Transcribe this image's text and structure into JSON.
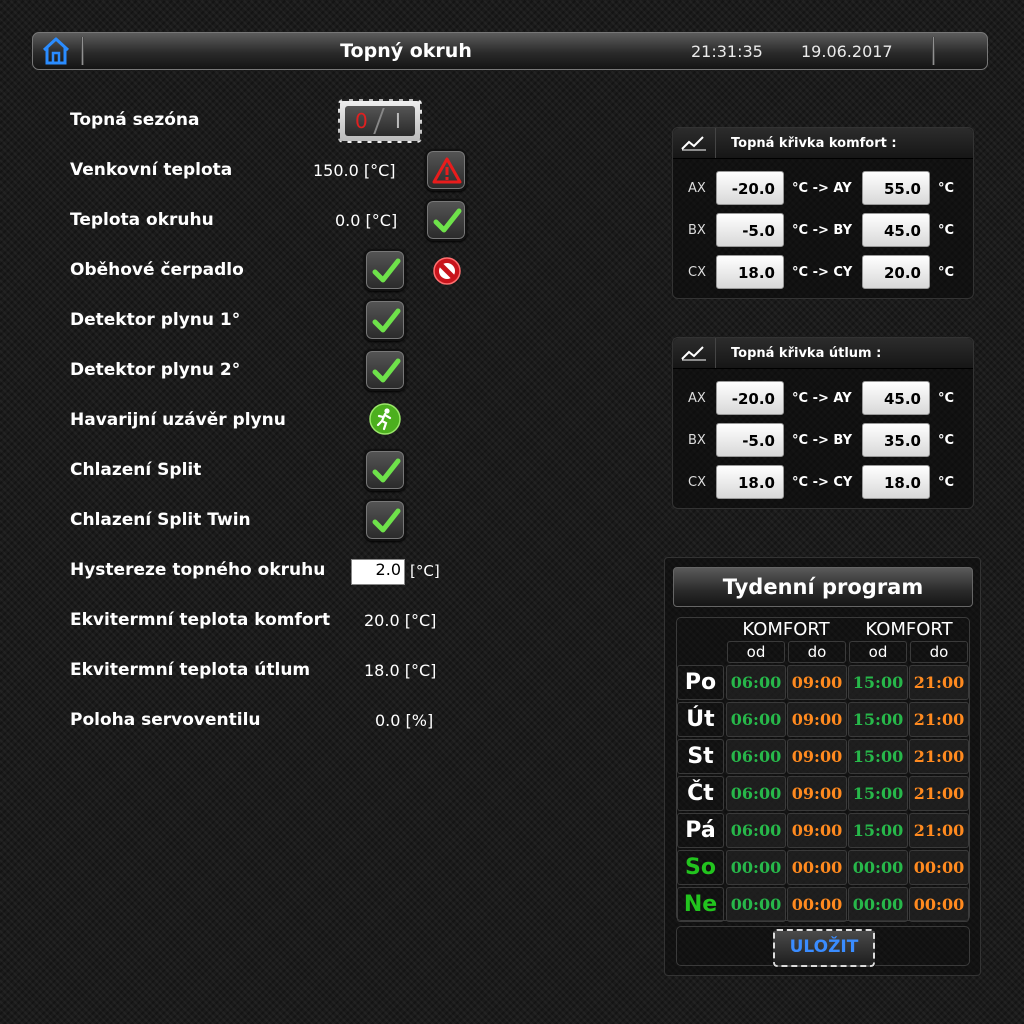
{
  "header": {
    "title": "Topný okruh",
    "time": "21:31:35",
    "date": "19.06.2017",
    "home_icon": "home-icon"
  },
  "rows": [
    {
      "label": "Topná sezóna",
      "control": "toggle",
      "toggle_off": "0",
      "toggle_on": "I",
      "state": "off"
    },
    {
      "label": "Venkovní teplota",
      "value": "150.0 [°C]",
      "status_icon": "warning-icon"
    },
    {
      "label": "Teplota okruhu",
      "value": "0.0 [°C]",
      "status_icon": "check-icon"
    },
    {
      "label": "Oběhové čerpadlo",
      "status_icon": "check-icon",
      "extra_icon": "forbidden-icon"
    },
    {
      "label": "Detektor plynu 1°",
      "status_icon": "check-icon"
    },
    {
      "label": "Detektor plynu 2°",
      "status_icon": "check-icon"
    },
    {
      "label": "Havarijní uzávěr plynu",
      "status_icon": "running-man-icon"
    },
    {
      "label": "Chlazení Split",
      "status_icon": "check-icon"
    },
    {
      "label": "Chlazení Split Twin",
      "status_icon": "check-icon"
    },
    {
      "label": "Hystereze topného okruhu",
      "input_value": "2.0",
      "unit": "[°C]"
    },
    {
      "label": "Ekvitermní teplota komfort",
      "value": "20.0 [°C]"
    },
    {
      "label": "Ekvitermní teplota útlum",
      "value": "18.0 [°C]"
    },
    {
      "label": "Poloha servoventilu",
      "value": "0.0 [%]"
    }
  ],
  "curve_comfort": {
    "title": "Topná křivka komfort :",
    "icon": "chart-line-icon",
    "rows": [
      {
        "in_label": "AX",
        "in_value": "-20.0",
        "arrow": "°C -> AY",
        "out_value": "55.0",
        "unit": "°C"
      },
      {
        "in_label": "BX",
        "in_value": "-5.0",
        "arrow": "°C -> BY",
        "out_value": "45.0",
        "unit": "°C"
      },
      {
        "in_label": "CX",
        "in_value": "18.0",
        "arrow": "°C -> CY",
        "out_value": "20.0",
        "unit": "°C"
      }
    ]
  },
  "curve_setback": {
    "title": "Topná křivka útlum :",
    "icon": "chart-line-icon",
    "rows": [
      {
        "in_label": "AX",
        "in_value": "-20.0",
        "arrow": "°C -> AY",
        "out_value": "45.0",
        "unit": "°C"
      },
      {
        "in_label": "BX",
        "in_value": "-5.0",
        "arrow": "°C -> BY",
        "out_value": "35.0",
        "unit": "°C"
      },
      {
        "in_label": "CX",
        "in_value": "18.0",
        "arrow": "°C -> CY",
        "out_value": "18.0",
        "unit": "°C"
      }
    ]
  },
  "weekly": {
    "title": "Tydenní program",
    "group1": "KOMFORT",
    "group2": "KOMFORT",
    "from": "od",
    "to": "do",
    "days": [
      {
        "day": "Po",
        "times": [
          "06:00",
          "09:00",
          "15:00",
          "21:00"
        ],
        "weekend": false
      },
      {
        "day": "Út",
        "times": [
          "06:00",
          "09:00",
          "15:00",
          "21:00"
        ],
        "weekend": false
      },
      {
        "day": "St",
        "times": [
          "06:00",
          "09:00",
          "15:00",
          "21:00"
        ],
        "weekend": false
      },
      {
        "day": "Čt",
        "times": [
          "06:00",
          "09:00",
          "15:00",
          "21:00"
        ],
        "weekend": false
      },
      {
        "day": "Pá",
        "times": [
          "06:00",
          "09:00",
          "15:00",
          "21:00"
        ],
        "weekend": false
      },
      {
        "day": "So",
        "times": [
          "00:00",
          "00:00",
          "00:00",
          "00:00"
        ],
        "weekend": true
      },
      {
        "day": "Ne",
        "times": [
          "00:00",
          "00:00",
          "00:00",
          "00:00"
        ],
        "weekend": true
      }
    ],
    "save_label": "ULOŽIT"
  },
  "colors": {
    "accent_blue": "#3a8cff",
    "start_green": "#27b84a",
    "end_orange": "#ff8a1f",
    "weekend_green": "#22c41e"
  }
}
